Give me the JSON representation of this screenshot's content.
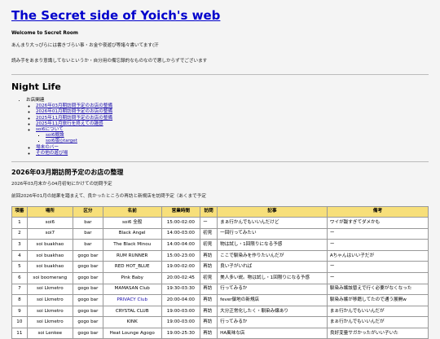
{
  "site": {
    "title": "The Secret side of Yoich's web",
    "welcome": "Welcome to Secret Room",
    "intro": [
      "あんまり大っぴらには書きづらい事・お金や夜遊び等諸々書いてます(汗",
      "読み手をあまり意識してないというか・自分用の備忘録的なものなので悪しからずでございます"
    ]
  },
  "section": {
    "title": "Night Life",
    "toc": {
      "label": "お店関連",
      "items": [
        "2026年03月期訪問予定のお店の整備",
        "2026年01月期訪問予定のお店の整備",
        "2025年11月期訪問予定のお店の整備",
        "2025年11月旅行を終えての雑感",
        "soi6について"
      ],
      "soi6_sub": [
        "soi6概論",
        "soi6版◎target"
      ],
      "more": [
        "場末のバー",
        "その他の遊び場"
      ]
    }
  },
  "article": {
    "title": "2026年03月期訪問予定のお店の整理",
    "para1": "2026年03月末から04月初旬にかけての訪問予定",
    "para2": "前回2026年01月の結果を踏まえて、良かったところの再訪と新規店を訪問予定（あくまで予定"
  },
  "table": {
    "headers": [
      "項番",
      "場所",
      "区分",
      "名前",
      "営業時間",
      "訪問",
      "記事",
      "備考"
    ],
    "rows": [
      [
        "1",
        "soi6",
        "bar",
        "soi6 全般",
        "15:00-02:00",
        "ー",
        "まぁ行かんでもいいんだけど",
        "ワイが跋すぎてダメかも",
        false
      ],
      [
        "2",
        "soi7",
        "bar",
        "Black Angel",
        "14:00-03:00",
        "初見",
        "一回行ってみたい",
        "ー",
        false
      ],
      [
        "3",
        "soi buakhao",
        "bar",
        "The Black Minou",
        "14:00-04:00",
        "初見",
        "物は試し・1回限りになる予感",
        "ー",
        false
      ],
      [
        "4",
        "soi buakhao",
        "gogo bar",
        "RUM RUNNER",
        "15:00-23:00",
        "再訪",
        "ここで馴染みを作りたいんだが",
        "Aちゃんはいい子だが",
        false
      ],
      [
        "5",
        "soi buakhao",
        "gogo bar",
        "RED HOT_BLUE",
        "19:00-02:00",
        "再訪",
        "良い子がいれば",
        "ー",
        false
      ],
      [
        "6",
        "soi boomerang",
        "gogo bar",
        "Pink Baby",
        "20:00-02:45",
        "初見",
        "美人多い説。物は試し・1回限りになる予感",
        "ー",
        false
      ],
      [
        "7",
        "soi Lkmetro",
        "gogo bar",
        "MAMASAN Club",
        "19:30-03:30",
        "再訪",
        "行ってみるか",
        "馴染み嬢該替えで行く必要がなくなった",
        false
      ],
      [
        "8",
        "soi Lkmetro",
        "gogo bar",
        "PRIVACY Club",
        "20:00-04:00",
        "再訪",
        "fever御地の新規店",
        "馴染み嬢が移籍してたので通う展開w",
        true
      ],
      [
        "9",
        "soi Lkmetro",
        "gogo bar",
        "CRYSTAL CLUB",
        "19:00-03:00",
        "再訪",
        "大分正常化したく・馴染み嬢あり",
        "まぁ行かんでもいいんだが",
        false
      ],
      [
        "10",
        "soi Lkmetro",
        "gogo bar",
        "KINK",
        "19:00-03:00",
        "再訪",
        "行ってみるか",
        "まぁ行かんでもいいんだが",
        false
      ],
      [
        "11",
        "soi Lenkee",
        "gogo bar",
        "Heat Lounge Agogo",
        "19:00-25:30",
        "再訪",
        "HA風味な店",
        "良好変量サガかったがいい子いた",
        false
      ]
    ]
  }
}
